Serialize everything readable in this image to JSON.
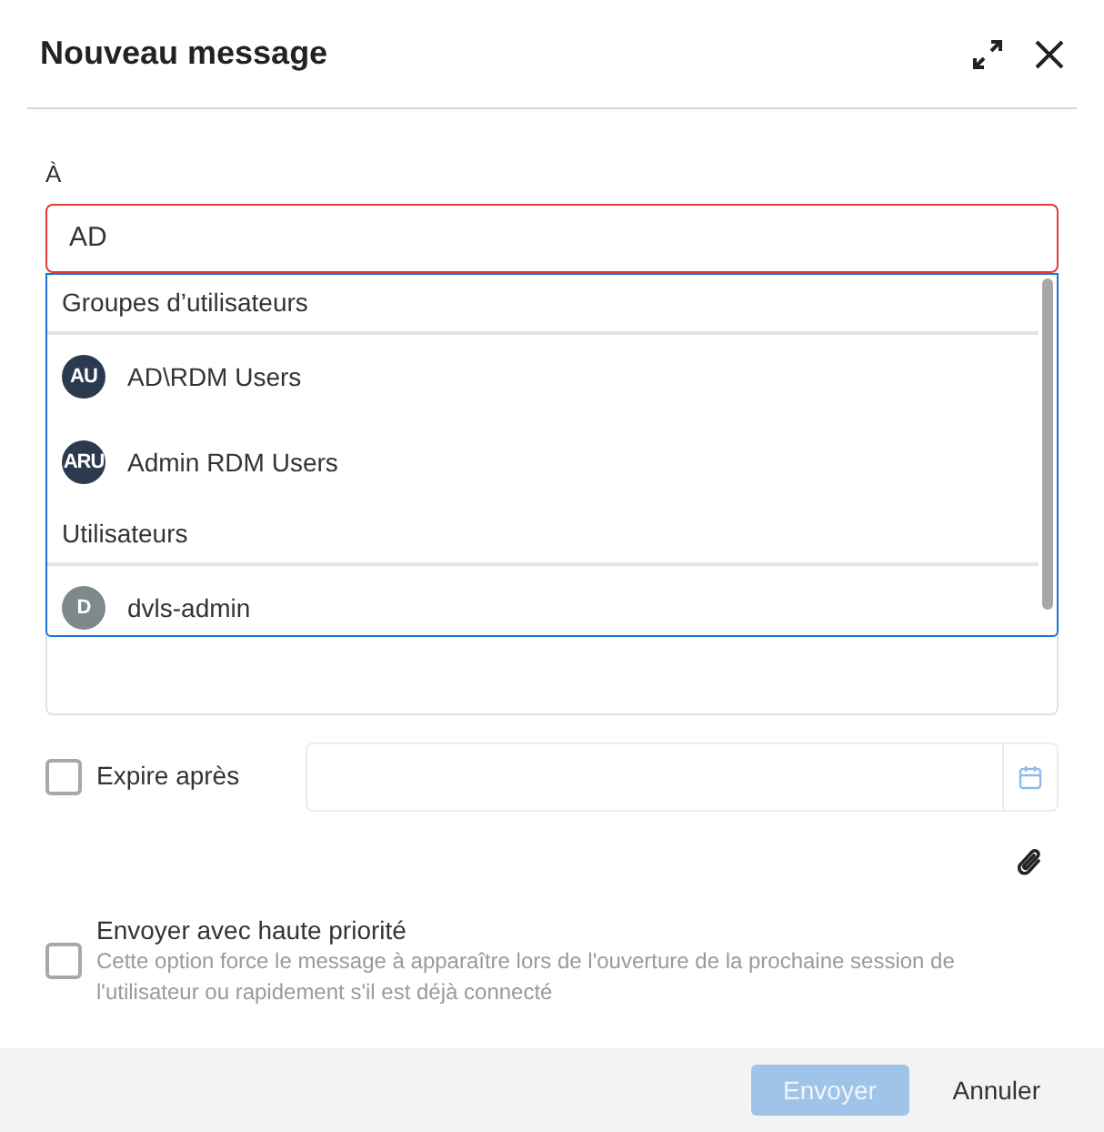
{
  "dialog": {
    "title": "Nouveau message"
  },
  "recipient": {
    "label": "À",
    "value": "AD",
    "invalid": true
  },
  "suggestions": [
    {
      "group": "Groupes d’utilisateurs",
      "items": [
        {
          "initials": "AU",
          "name": "AD\\RDM Users",
          "color": "#2c3a4f"
        },
        {
          "initials": "ARU",
          "name": "Admin RDM Users",
          "color": "#2c3a4f"
        }
      ]
    },
    {
      "group": "Utilisateurs",
      "items": [
        {
          "initials": "D",
          "name": "dvls-admin",
          "color": "#7f898b"
        }
      ]
    }
  ],
  "expire": {
    "label": "Expire après",
    "checked": false
  },
  "priority": {
    "label": "Envoyer avec haute priorité",
    "description": "Cette option force le message à apparaître lors de l'ouverture de la prochaine session de l'utilisateur ou rapidement s'il est déjà connecté",
    "checked": false
  },
  "buttons": [
    {
      "label": "Envoyer",
      "kind": "primary",
      "disabled": true
    },
    {
      "label": "Annuler",
      "kind": "plain",
      "disabled": false
    }
  ]
}
